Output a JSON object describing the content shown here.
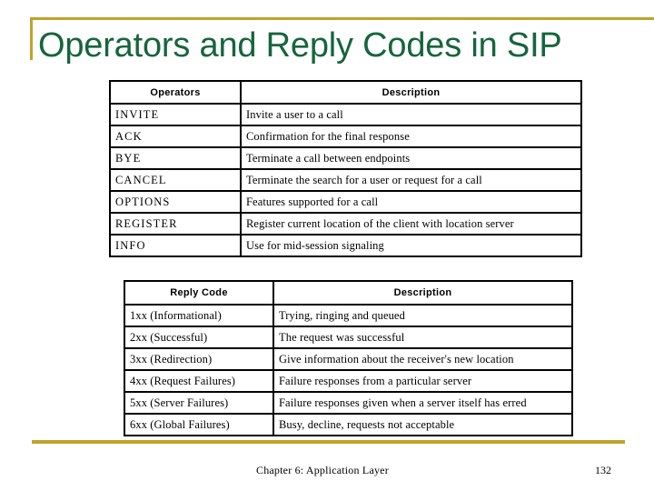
{
  "slide": {
    "title": "Operators and Reply Codes in SIP",
    "accent_color": "#c0a32b",
    "title_color": "#16653d"
  },
  "operators_table": {
    "headers": {
      "key": "Operators",
      "description": "Description"
    },
    "rows": [
      {
        "key": "INVITE",
        "description": "Invite a user to a call"
      },
      {
        "key": "ACK",
        "description": "Confirmation for the final response"
      },
      {
        "key": "BYE",
        "description": "Terminate a call between endpoints"
      },
      {
        "key": "CANCEL",
        "description": "Terminate the search for a user or request for a call"
      },
      {
        "key": "OPTIONS",
        "description": "Features supported for a call"
      },
      {
        "key": "REGISTER",
        "description": "Register current location of the client with location server"
      },
      {
        "key": "INFO",
        "description": "Use for mid-session signaling"
      }
    ]
  },
  "reply_codes_table": {
    "headers": {
      "key": "Reply Code",
      "description": "Description"
    },
    "rows": [
      {
        "key": "1xx (Informational)",
        "description": "Trying, ringing and queued"
      },
      {
        "key": "2xx (Successful)",
        "description": "The request was successful"
      },
      {
        "key": "3xx (Redirection)",
        "description": "Give information about the receiver's new location"
      },
      {
        "key": "4xx (Request Failures)",
        "description": "Failure responses from a particular server"
      },
      {
        "key": "5xx (Server Failures)",
        "description": "Failure responses given when a server itself has erred"
      },
      {
        "key": "6xx (Global Failures)",
        "description": "Busy, decline, requests not acceptable"
      }
    ]
  },
  "footer": {
    "chapter": "Chapter 6: Application Layer",
    "page_number": "132"
  }
}
